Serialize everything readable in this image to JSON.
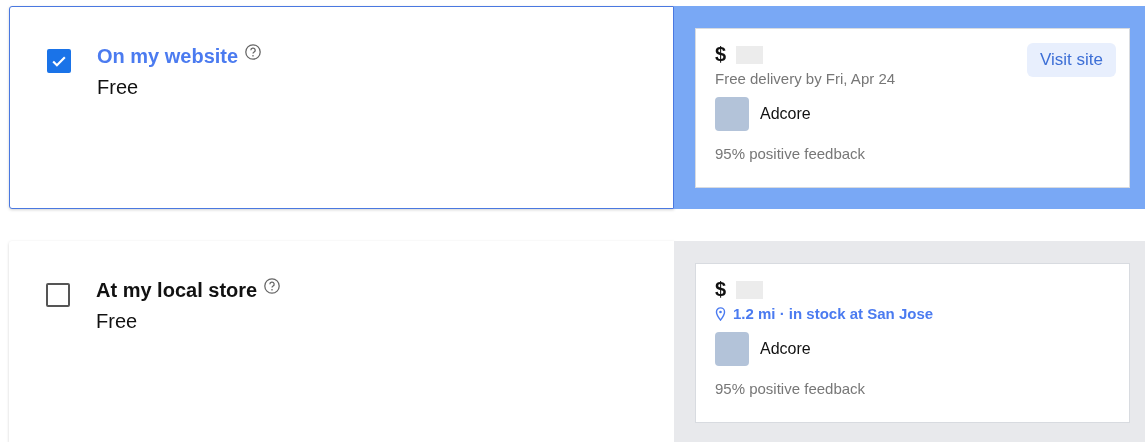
{
  "options": [
    {
      "checked": true,
      "title": "On my website",
      "price": "Free",
      "offer": {
        "currency": "$",
        "detail": {
          "kind": "delivery",
          "text": "Free delivery by Fri, Apr 24"
        },
        "button": "Visit site",
        "seller": "Adcore",
        "feedback": "95% positive feedback"
      }
    },
    {
      "checked": false,
      "title": "At my local store",
      "price": "Free",
      "offer": {
        "currency": "$",
        "detail": {
          "kind": "location",
          "text": "1.2 mi · in stock at San Jose"
        },
        "seller": "Adcore",
        "feedback": "95% positive feedback"
      }
    }
  ]
}
